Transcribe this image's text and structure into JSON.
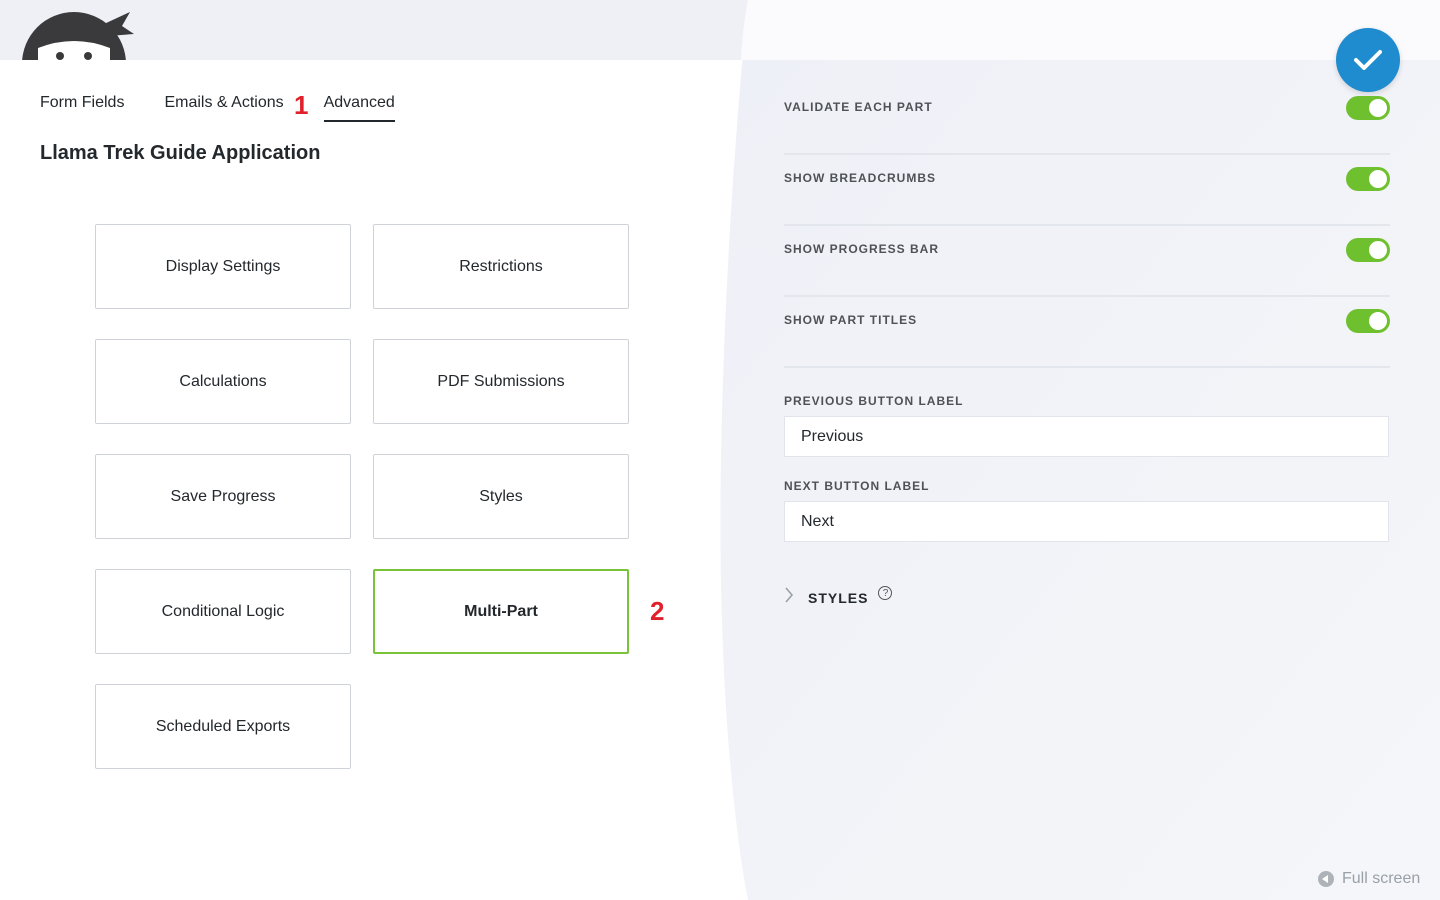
{
  "tabs": [
    {
      "label": "Form Fields"
    },
    {
      "label": "Emails & Actions"
    },
    {
      "label": "Advanced"
    }
  ],
  "active_tab": "Advanced",
  "markers": {
    "one": "1",
    "two": "2"
  },
  "form_title": "Llama Trek Guide Application",
  "cards": [
    {
      "label": "Display Settings"
    },
    {
      "label": "Restrictions"
    },
    {
      "label": "Calculations"
    },
    {
      "label": "PDF Submissions"
    },
    {
      "label": "Save Progress"
    },
    {
      "label": "Styles"
    },
    {
      "label": "Conditional Logic"
    },
    {
      "label": "Multi-Part"
    },
    {
      "label": "Scheduled Exports"
    }
  ],
  "selected_card": "Multi-Part",
  "settings": [
    {
      "label": "VALIDATE EACH PART",
      "enabled": true
    },
    {
      "label": "SHOW BREADCRUMBS",
      "enabled": true
    },
    {
      "label": "SHOW PROGRESS BAR",
      "enabled": true
    },
    {
      "label": "SHOW PART TITLES",
      "enabled": true
    }
  ],
  "fields": {
    "previous_label": "PREVIOUS BUTTON LABEL",
    "previous_value": "Previous",
    "next_label": "NEXT BUTTON LABEL",
    "next_value": "Next"
  },
  "styles_section": {
    "label": "STYLES",
    "help": "?"
  },
  "fullscreen_label": "Full screen",
  "colors": {
    "accent_green": "#6fc02f",
    "selected_border": "#78c337",
    "confirm_blue": "#1e8cce",
    "marker_red": "#e0202a"
  },
  "icons": [
    "ninja-logo-icon",
    "checkmark-icon",
    "chevron-right-icon",
    "help-icon",
    "fullscreen-icon"
  ]
}
